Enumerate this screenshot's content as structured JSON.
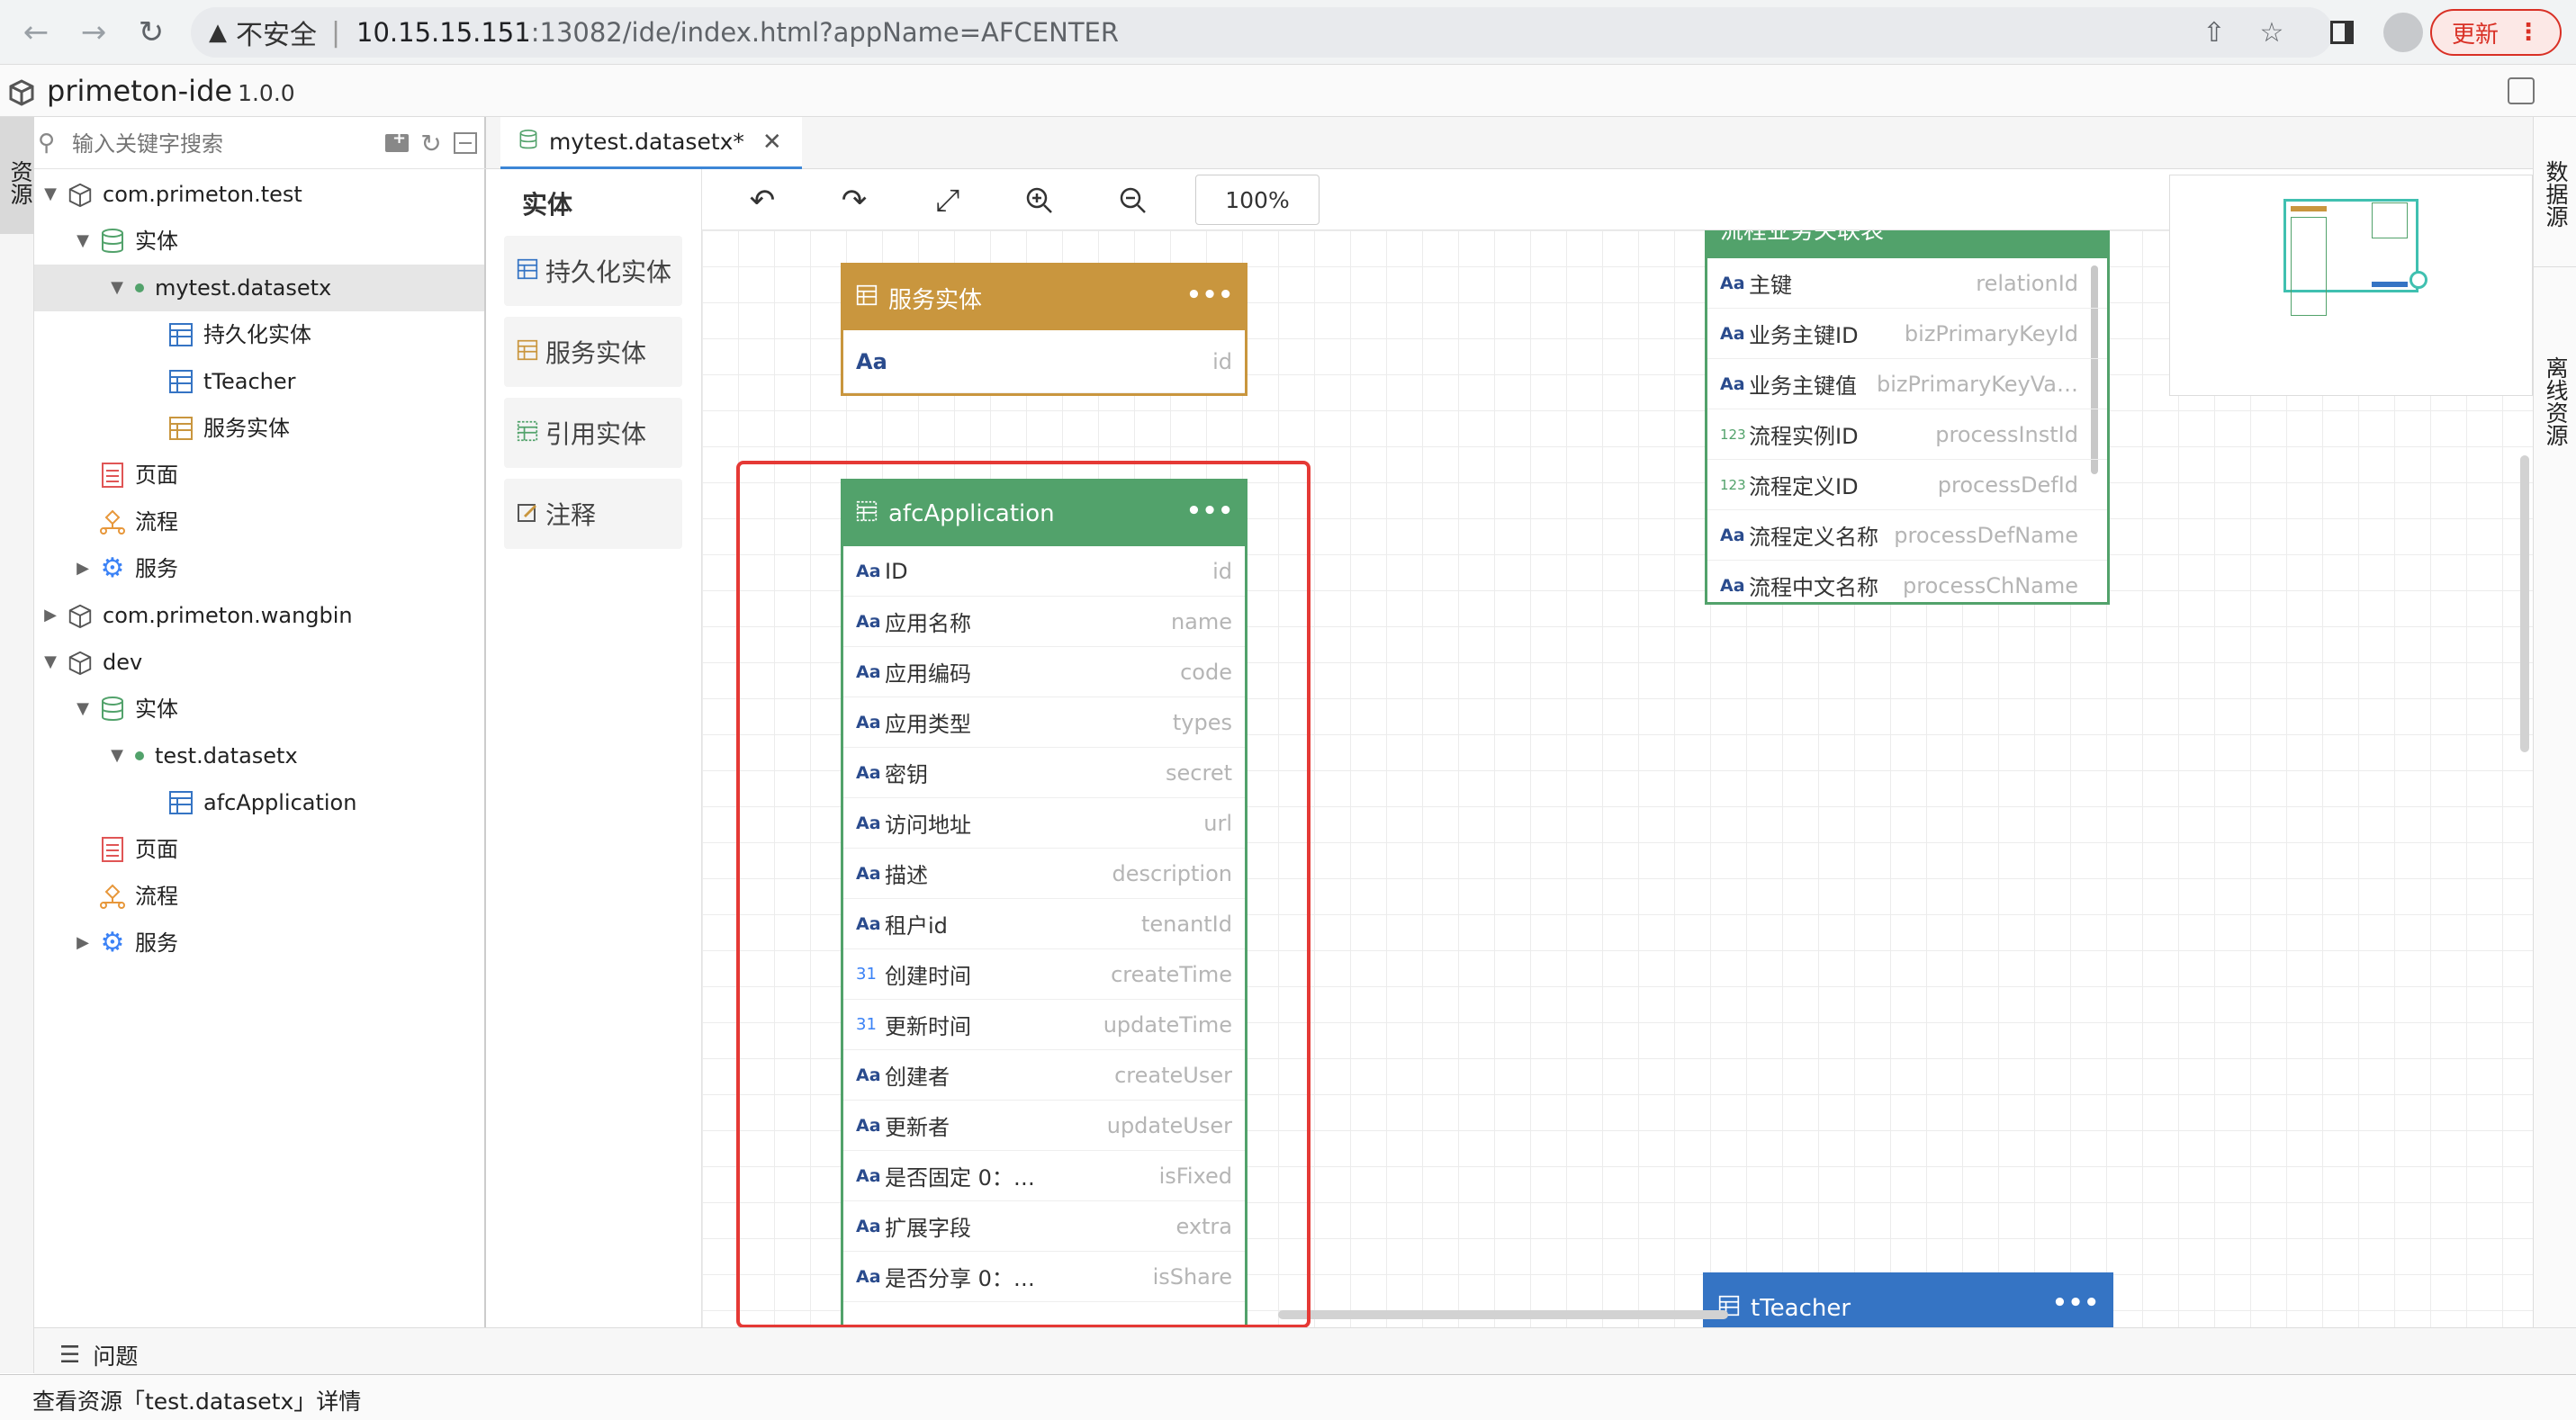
{
  "browser": {
    "security_label": "不安全",
    "url_host": "10.15.15.151",
    "url_rest": ":13082/ide/index.html?appName=AFCENTER",
    "update_label": "更新"
  },
  "app": {
    "name": "primeton-ide",
    "version": "1.0.0"
  },
  "left_vtab": "资源",
  "right_vtabs": [
    "数据源",
    "离线资源"
  ],
  "search": {
    "placeholder": "输入关键字搜索"
  },
  "tree": [
    {
      "label": "com.primeton.test"
    },
    {
      "label": "实体"
    },
    {
      "label": "mytest.datasetx"
    },
    {
      "label": "持久化实体"
    },
    {
      "label": "tTeacher"
    },
    {
      "label": "服务实体"
    },
    {
      "label": "页面"
    },
    {
      "label": "流程"
    },
    {
      "label": "服务"
    },
    {
      "label": "com.primeton.wangbin"
    },
    {
      "label": "dev"
    },
    {
      "label": "实体"
    },
    {
      "label": "test.datasetx"
    },
    {
      "label": "afcApplication"
    },
    {
      "label": "页面"
    },
    {
      "label": "流程"
    },
    {
      "label": "服务"
    }
  ],
  "editor_tab": {
    "label": "mytest.datasetx*"
  },
  "palette": {
    "title": "实体",
    "items": [
      "持久化实体",
      "服务实体",
      "引用实体",
      "注释"
    ]
  },
  "zoom": "100%",
  "cards": {
    "service": {
      "title": "服务实体",
      "fields": [
        {
          "type": "Aa",
          "name": "",
          "code": "id"
        }
      ]
    },
    "afc": {
      "title": "afcApplication",
      "fields": [
        {
          "type": "Aa",
          "name": "ID",
          "code": "id"
        },
        {
          "type": "Aa",
          "name": "应用名称",
          "code": "name"
        },
        {
          "type": "Aa",
          "name": "应用编码",
          "code": "code"
        },
        {
          "type": "Aa",
          "name": "应用类型",
          "code": "types"
        },
        {
          "type": "Aa",
          "name": "密钥",
          "code": "secret"
        },
        {
          "type": "Aa",
          "name": "访问地址",
          "code": "url"
        },
        {
          "type": "Aa",
          "name": "描述",
          "code": "description"
        },
        {
          "type": "Aa",
          "name": "租户id",
          "code": "tenantId"
        },
        {
          "type": "31",
          "name": "创建时间",
          "code": "createTime"
        },
        {
          "type": "31",
          "name": "更新时间",
          "code": "updateTime"
        },
        {
          "type": "Aa",
          "name": "创建者",
          "code": "createUser"
        },
        {
          "type": "Aa",
          "name": "更新者",
          "code": "updateUser"
        },
        {
          "type": "Aa",
          "name": "是否固定 0：…",
          "code": "isFixed"
        },
        {
          "type": "Aa",
          "name": "扩展字段",
          "code": "extra"
        },
        {
          "type": "Aa",
          "name": "是否分享 0：…",
          "code": "isShare"
        }
      ]
    },
    "relation": {
      "title": "流程业务关联表",
      "fields": [
        {
          "type": "Aa",
          "name": "主键",
          "code": "relationId"
        },
        {
          "type": "Aa",
          "name": "业务主键ID",
          "code": "bizPrimaryKeyId"
        },
        {
          "type": "Aa",
          "name": "业务主键值",
          "code": "bizPrimaryKeyVa…"
        },
        {
          "type": "123",
          "name": "流程实例ID",
          "code": "processInstId"
        },
        {
          "type": "123",
          "name": "流程定义ID",
          "code": "processDefId"
        },
        {
          "type": "Aa",
          "name": "流程定义名称",
          "code": "processDefName"
        },
        {
          "type": "Aa",
          "name": "流程中文名称",
          "code": "processChName"
        }
      ]
    },
    "teacher": {
      "title": "tTeacher"
    }
  },
  "problems_label": "问题",
  "status_text": "查看资源「test.datasetx」详情",
  "colors": {
    "service_card": "#c9963e",
    "afc_card": "#52a26b",
    "teacher_card": "#3574c4",
    "highlight": "#e53935"
  }
}
